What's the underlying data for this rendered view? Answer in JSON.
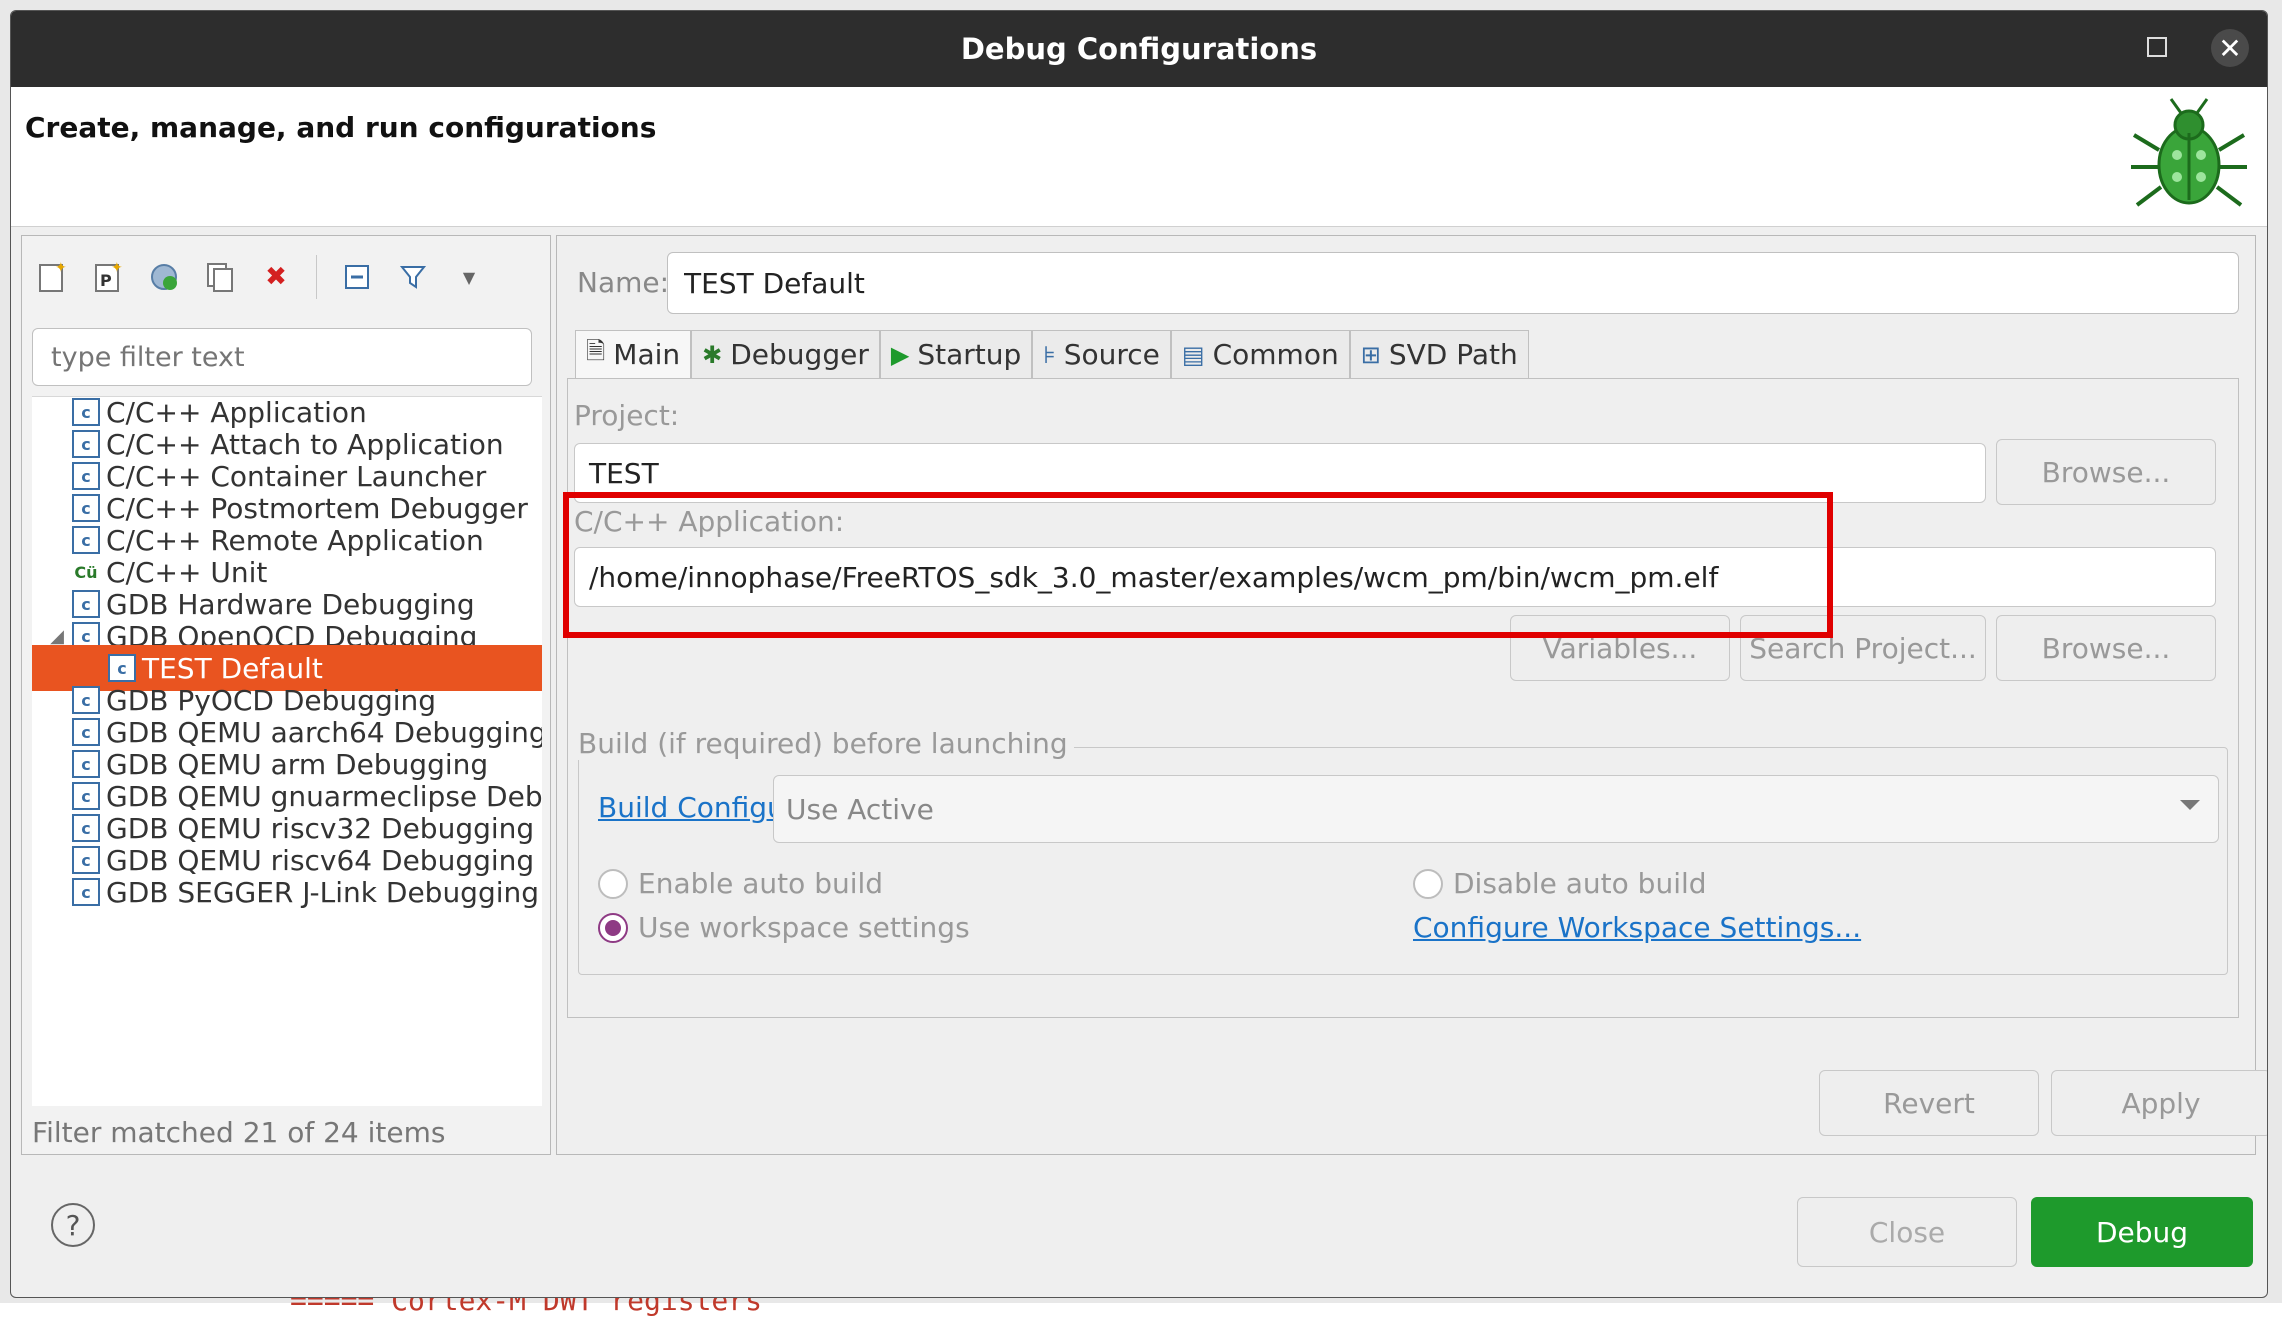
{
  "window": {
    "title": "Debug Configurations"
  },
  "header": {
    "subtitle": "Create, manage, and run configurations"
  },
  "left": {
    "filter_placeholder": "type filter text",
    "items": [
      {
        "label": "C/C++ Application",
        "selected": false
      },
      {
        "label": "C/C++ Attach to Application",
        "selected": false
      },
      {
        "label": "C/C++ Container Launcher",
        "selected": false
      },
      {
        "label": "C/C++ Postmortem Debugger",
        "selected": false
      },
      {
        "label": "C/C++ Remote Application",
        "selected": false
      },
      {
        "label": "C/C++ Unit",
        "selected": false
      },
      {
        "label": "GDB Hardware Debugging",
        "selected": false
      },
      {
        "label": "GDB OpenOCD Debugging",
        "selected": false
      },
      {
        "label": "TEST Default",
        "selected": true
      },
      {
        "label": "GDB PyOCD Debugging",
        "selected": false
      },
      {
        "label": "GDB QEMU aarch64 Debugging",
        "selected": false
      },
      {
        "label": "GDB QEMU arm Debugging",
        "selected": false
      },
      {
        "label": "GDB QEMU gnuarmeclipse Debu",
        "selected": false
      },
      {
        "label": "GDB QEMU riscv32 Debugging",
        "selected": false
      },
      {
        "label": "GDB QEMU riscv64 Debugging",
        "selected": false
      },
      {
        "label": "GDB SEGGER J-Link Debugging",
        "selected": false
      }
    ],
    "status": "Filter matched 21 of 24 items"
  },
  "right": {
    "name_label": "Name:",
    "name_value": "TEST Default",
    "tabs": [
      {
        "label": "Main",
        "icon": "file-icon"
      },
      {
        "label": "Debugger",
        "icon": "bug-icon"
      },
      {
        "label": "Startup",
        "icon": "play-icon"
      },
      {
        "label": "Source",
        "icon": "source-icon"
      },
      {
        "label": "Common",
        "icon": "table-icon"
      },
      {
        "label": "SVD Path",
        "icon": "hierarchy-icon"
      }
    ],
    "project_label": "Project:",
    "project_value": "TEST",
    "browse_label": "Browse...",
    "app_label": "C/C++ Application:",
    "app_value": "/home/innophase/FreeRTOS_sdk_3.0_master/examples/wcm_pm/bin/wcm_pm.elf",
    "variables_label": "Variables...",
    "search_project_label": "Search Project...",
    "browse2_label": "Browse...",
    "build_group_title": "Build (if required) before launching",
    "build_config_link": "Build Configuration:",
    "build_config_value": "Use Active",
    "enable_auto_build": "Enable auto build",
    "disable_auto_build": "Disable auto build",
    "use_workspace_settings": "Use workspace settings",
    "configure_workspace_link": "Configure Workspace Settings...",
    "revert_label": "Revert",
    "apply_label": "Apply"
  },
  "bottom": {
    "help_icon": "?",
    "close_label": "Close",
    "debug_label": "Debug"
  },
  "background_text": "===== Cortex-M DWT registers"
}
